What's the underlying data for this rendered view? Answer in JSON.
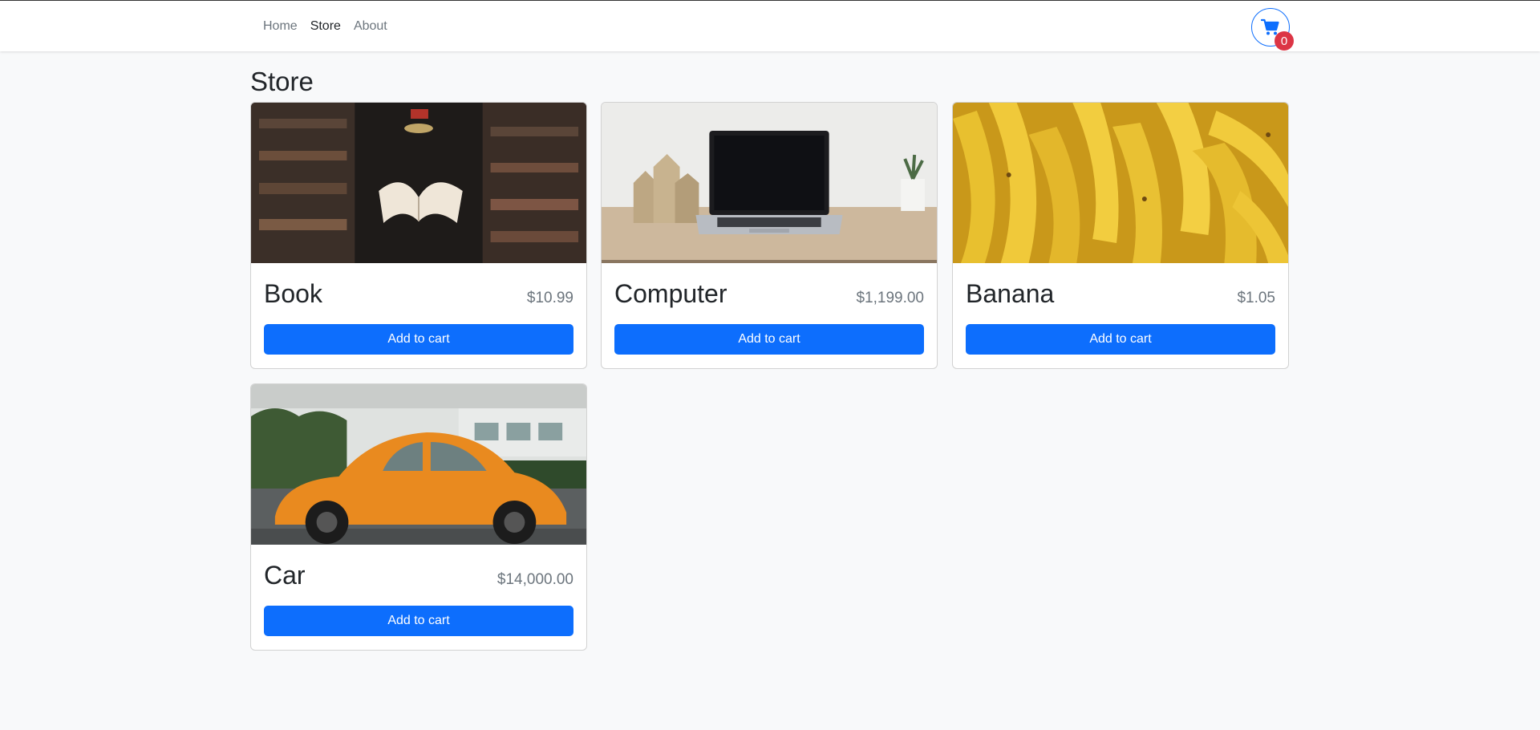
{
  "nav": {
    "items": [
      {
        "label": "Home",
        "active": false
      },
      {
        "label": "Store",
        "active": true
      },
      {
        "label": "About",
        "active": false
      }
    ],
    "cart_count": "0",
    "cart_icon": "cart-icon"
  },
  "page": {
    "title": "Store"
  },
  "products": [
    {
      "name": "Book",
      "price": "$10.99",
      "button_label": "Add to cart",
      "image": "floating-book-library-image"
    },
    {
      "name": "Computer",
      "price": "$1,199.00",
      "button_label": "Add to cart",
      "image": "laptop-on-desk-image"
    },
    {
      "name": "Banana",
      "price": "$1.05",
      "button_label": "Add to cart",
      "image": "bananas-image"
    },
    {
      "name": "Car",
      "price": "$14,000.00",
      "button_label": "Add to cart",
      "image": "orange-beetle-car-image"
    }
  ],
  "colors": {
    "primary": "#0d6efd",
    "badge": "#dc3545",
    "background": "#f8f9fa"
  }
}
